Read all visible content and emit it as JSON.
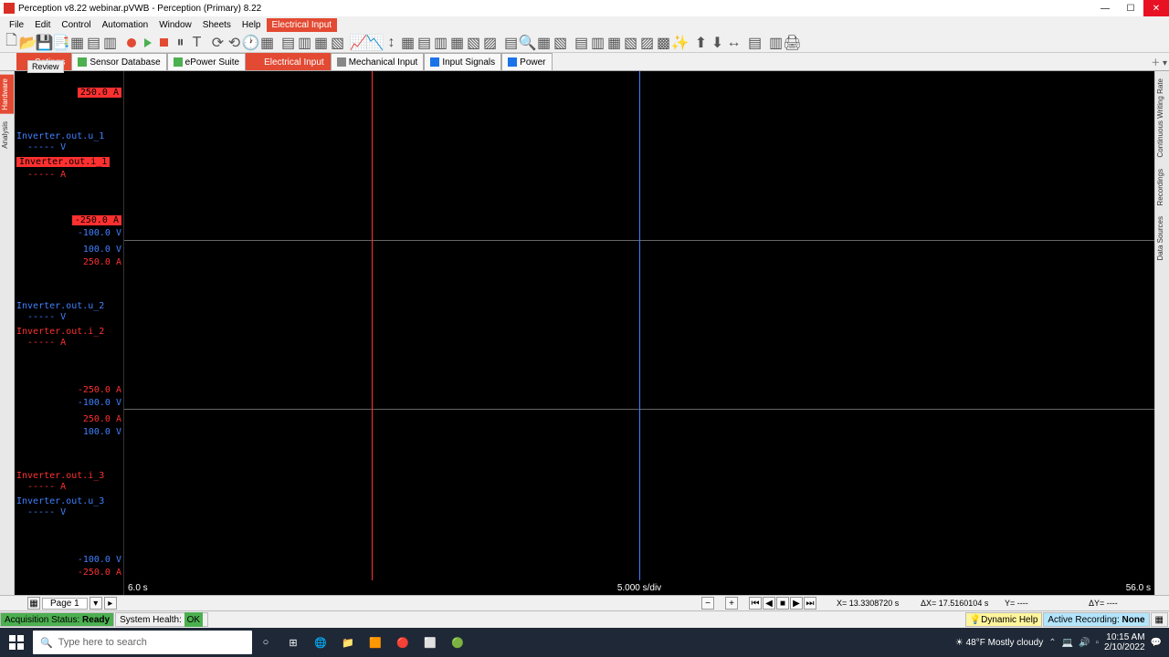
{
  "title": "Perception v8.22 webinar.pVWB - Perception (Primary) 8.22",
  "menu": [
    "File",
    "Edit",
    "Control",
    "Automation",
    "Window",
    "Sheets",
    "Help"
  ],
  "menu_highlight": "Electrical Input",
  "tabs": [
    {
      "label": "Setings",
      "icon": "red",
      "active_alt": true
    },
    {
      "label": "Sensor Database",
      "icon": "green"
    },
    {
      "label": "ePower Suite",
      "icon": "green"
    },
    {
      "label": "Electrical Input",
      "icon": "red",
      "active": true
    },
    {
      "label": "Mechanical Input",
      "icon": "gray"
    },
    {
      "label": "Input Signals",
      "icon": "blue"
    },
    {
      "label": "Power",
      "icon": "blue"
    }
  ],
  "review_label": "Review",
  "vtabs_left": [
    "Hardware",
    "Analysis"
  ],
  "vtabs_right": [
    "Continuous Writing Rate",
    "Recordings",
    "Data Sources"
  ],
  "tracks": {
    "1": {
      "top_hl": {
        "text": "250.0  A",
        "cls": "hlred"
      },
      "mid_blue": "Inverter.out.u_1",
      "mid_blue_sub": "----- V",
      "mid_red": "Inverter.out.i_1",
      "mid_red_sub": "----- A",
      "bot_hl": {
        "text": "-250.0  A",
        "cls": "hlred"
      },
      "bot_blue": "-100.0  V"
    },
    "2": {
      "top_blue": "100.0  V",
      "top_red": "250.0  A",
      "mid_blue": "Inverter.out.u_2",
      "mid_blue_sub": "----- V",
      "mid_red": "Inverter.out.i_2",
      "mid_red_sub": "----- A",
      "bot_red": "-250.0  A",
      "bot_blue": "-100.0  V"
    },
    "3": {
      "top_red": "250.0  A",
      "top_blue": "100.0  V",
      "mid_red": "Inverter.out.i_3",
      "mid_red_sub": "----- A",
      "mid_blue": "Inverter.out.u_3",
      "mid_blue_sub": "----- V",
      "bot_blue": "-100.0  V",
      "bot_red": "-250.0  A"
    }
  },
  "cursors": {
    "red_pos_pct": 24,
    "blue_pos_pct": 50
  },
  "timeaxis": {
    "left": "6.0 s",
    "center": "5.000  s/div",
    "right": "56.0 s"
  },
  "pagebar": {
    "page": "Page 1",
    "x": "X= 13.3308720 s",
    "dx": "ΔX= 17.5160104 s",
    "y": "Y= ----",
    "dy": "ΔY= ----"
  },
  "status": {
    "acq_label": "Acquisition Status:",
    "acq_val": "Ready",
    "sys_label": "System Health:",
    "sys_val": "OK",
    "help": "Dynamic Help",
    "rec": "Active Recording:",
    "rec_val": "None"
  },
  "taskbar": {
    "search_placeholder": "Type here to search",
    "weather": "48°F  Mostly cloudy",
    "time": "10:15 AM",
    "date": "2/10/2022"
  }
}
